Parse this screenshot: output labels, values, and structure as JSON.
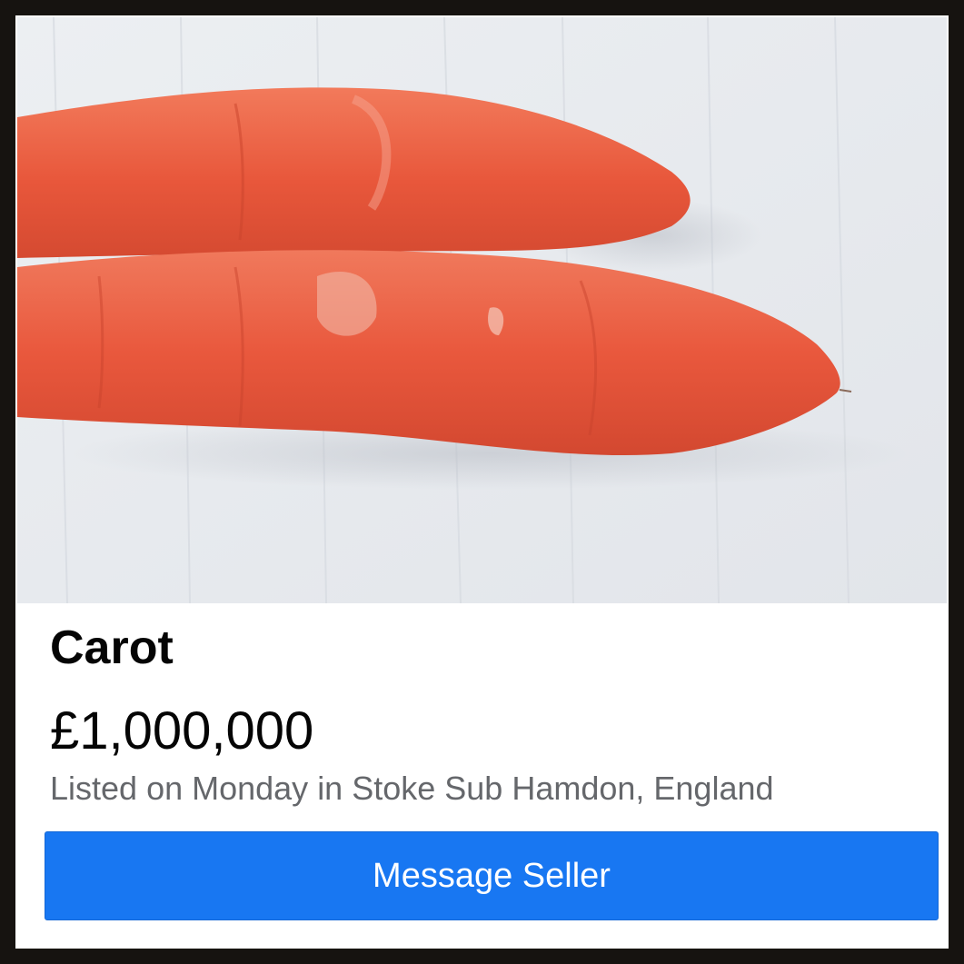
{
  "listing": {
    "title": "Carot",
    "price": "£1,000,000",
    "meta": "Listed on Monday in Stoke Sub Hamdon, England",
    "cta_label": "Message Seller"
  },
  "colors": {
    "cta_background": "#1877f2",
    "cta_text": "#ffffff",
    "title_text": "#050505",
    "meta_text": "#65676b",
    "outer_frame": "#161310"
  }
}
